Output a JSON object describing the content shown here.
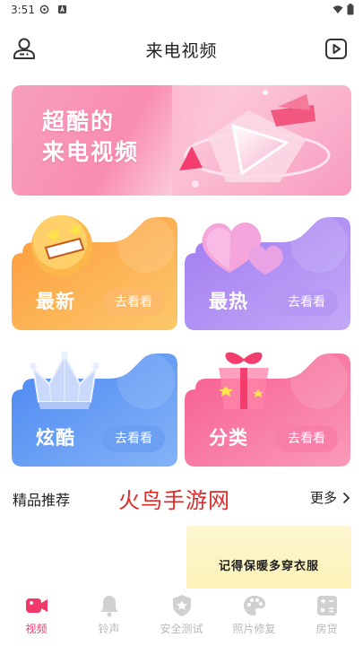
{
  "status_bar": {
    "time": "3:51"
  },
  "header": {
    "title": "来电视频"
  },
  "banner": {
    "line1": "超酷的",
    "line2": "来电视频"
  },
  "categories": [
    {
      "label": "最新",
      "action": "去看看"
    },
    {
      "label": "最热",
      "action": "去看看"
    },
    {
      "label": "炫酷",
      "action": "去看看"
    },
    {
      "label": "分类",
      "action": "去看看"
    }
  ],
  "section": {
    "title": "精品推荐",
    "watermark": "火鸟手游网",
    "more": "更多"
  },
  "recommend": {
    "caption": "记得保暖多穿衣服"
  },
  "bottom_nav": [
    {
      "label": "视频",
      "active": true,
      "icon": "video-icon"
    },
    {
      "label": "铃声",
      "active": false,
      "icon": "bell-icon"
    },
    {
      "label": "安全测试",
      "active": false,
      "icon": "shield-icon"
    },
    {
      "label": "照片修复",
      "active": false,
      "icon": "palette-icon"
    },
    {
      "label": "房贷",
      "active": false,
      "icon": "calculator-icon"
    }
  ],
  "colors": {
    "accent": "#f2386b",
    "orange": "#fcae45",
    "purple": "#a988f3",
    "blue": "#5e94f3",
    "pink": "#f6729f"
  }
}
